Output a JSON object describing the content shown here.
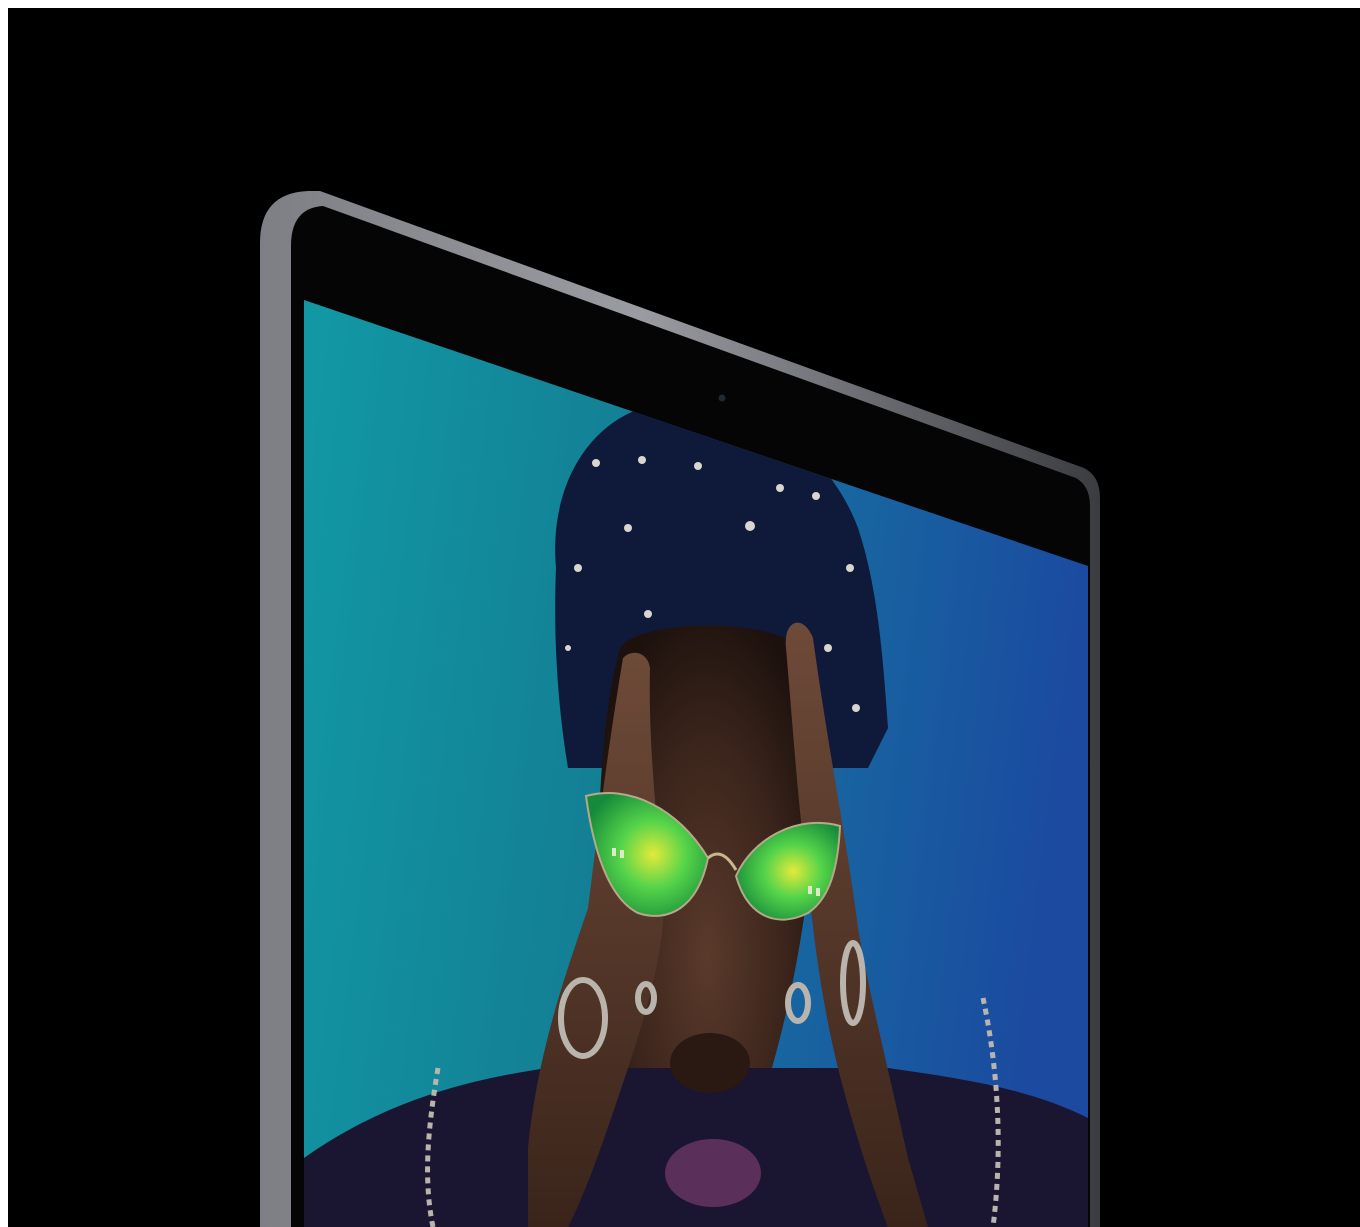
{
  "scene": {
    "subject": "laptop-display",
    "device_orientation": "angled-perspective",
    "webcam": true
  },
  "colors": {
    "page_border": "#ffffff",
    "backdrop": "#000000",
    "chassis_light": "#8a8c92",
    "chassis_dark": "#3b3c40",
    "bezel": "#050505",
    "screen_teal": "#138a9a",
    "screen_blue": "#1b4f9c",
    "hair": "#0f1a3a",
    "skin_dark": "#2a1a14",
    "skin_light": "#6a4734",
    "lens_green": "#33d14f",
    "lens_yellow": "#d8e23a",
    "jewelry": "#b9b5ad",
    "lips": "#5a2f5a"
  },
  "icons": {
    "webcam": "camera-dot",
    "glasses": "cat-eye-sunglasses",
    "rings": "ring-shapes",
    "chains": "chain-necklaces"
  }
}
